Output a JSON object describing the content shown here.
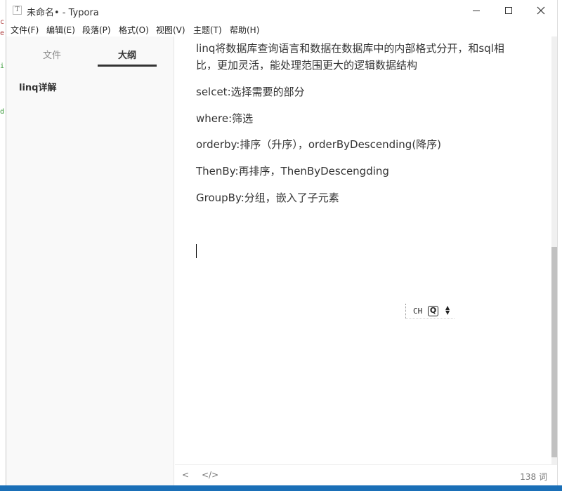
{
  "window": {
    "title": "未命名• - Typora",
    "app_icon_letter": "T",
    "controls": [
      "minimize",
      "maximize",
      "close"
    ]
  },
  "menu": [
    "文件(F)",
    "编辑(E)",
    "段落(P)",
    "格式(O)",
    "视图(V)",
    "主题(T)",
    "帮助(H)"
  ],
  "sidebar": {
    "tabs": [
      {
        "label": "文件",
        "active": false
      },
      {
        "label": "大纲",
        "active": true
      }
    ],
    "outline": [
      "linq详解"
    ]
  },
  "editor": {
    "paragraphs": [
      "linq将数据库查询语言和数据在数据库中的内部格式分开，和sql相",
      "比，更加灵活，能处理范围更大的逻辑数据结构",
      "selcet:选择需要的部分",
      "where:筛选",
      "orderby:排序（升序），orderByDescending(降序)",
      "ThenBy:再排序，ThenByDescengding",
      "GroupBy:分组，嵌入了子元素"
    ]
  },
  "ime": {
    "mode": "CH",
    "icon": "Q"
  },
  "statusbar": {
    "back_symbol": "<",
    "source_symbol": "</>",
    "word_count": "138 词"
  },
  "background_fragments": [
    "c",
    "e",
    "i",
    "d"
  ],
  "colors": {
    "sidebar_bg": "#f9f9f9",
    "text": "#333333",
    "taskbar": "#1a6fb7",
    "scroll_thumb": "#c1c1c1"
  }
}
